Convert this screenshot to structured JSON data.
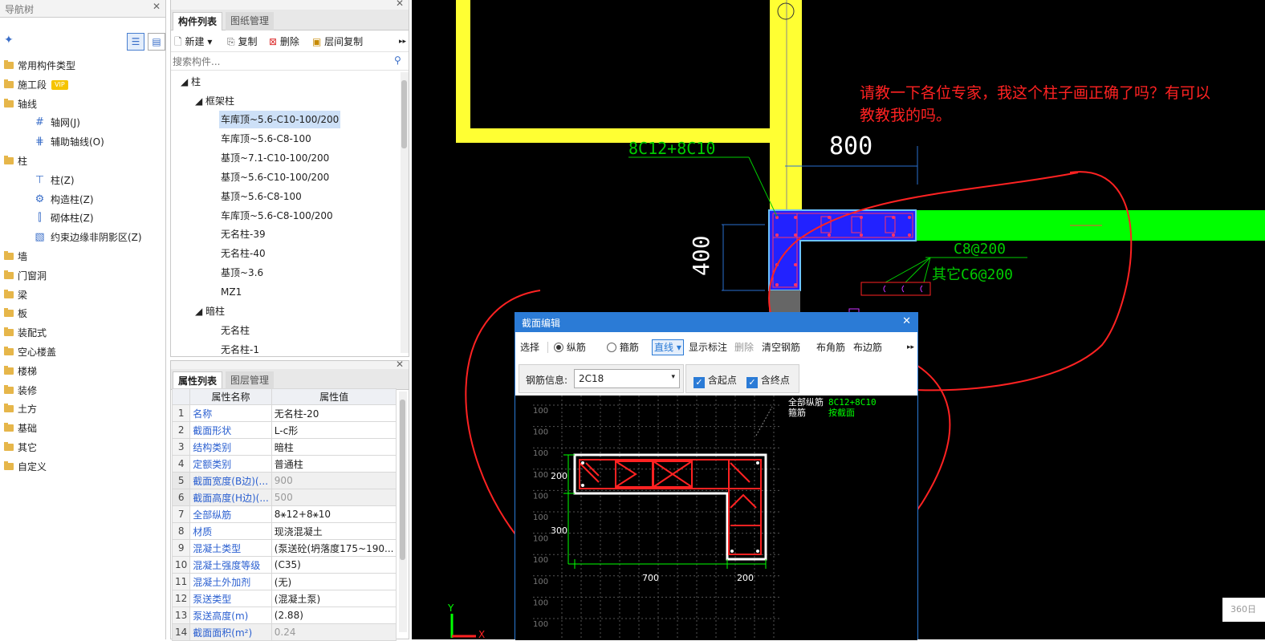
{
  "nav": {
    "title": "导航树",
    "items": [
      {
        "label": "常用构件类型",
        "type": "folder"
      },
      {
        "label": "施工段",
        "type": "folder",
        "badge": "VIP"
      },
      {
        "label": "轴线",
        "type": "open"
      },
      {
        "label": "轴网(J)",
        "type": "child",
        "icon": "grid"
      },
      {
        "label": "辅助轴线(O)",
        "type": "child",
        "icon": "grid2"
      },
      {
        "label": "柱",
        "type": "open"
      },
      {
        "label": "柱(Z)",
        "type": "child",
        "icon": "column",
        "selected": true
      },
      {
        "label": "构造柱(Z)",
        "type": "child",
        "icon": "gear"
      },
      {
        "label": "砌体柱(Z)",
        "type": "child",
        "icon": "column2"
      },
      {
        "label": "约束边缘非阴影区(Z)",
        "type": "child",
        "icon": "hatch"
      },
      {
        "label": "墙",
        "type": "folder"
      },
      {
        "label": "门窗洞",
        "type": "folder"
      },
      {
        "label": "梁",
        "type": "folder"
      },
      {
        "label": "板",
        "type": "folder"
      },
      {
        "label": "装配式",
        "type": "folder"
      },
      {
        "label": "空心楼盖",
        "type": "folder"
      },
      {
        "label": "楼梯",
        "type": "folder"
      },
      {
        "label": "装修",
        "type": "folder"
      },
      {
        "label": "土方",
        "type": "folder"
      },
      {
        "label": "基础",
        "type": "folder"
      },
      {
        "label": "其它",
        "type": "folder"
      },
      {
        "label": "自定义",
        "type": "folder"
      }
    ]
  },
  "components": {
    "tabs": [
      "构件列表",
      "图纸管理"
    ],
    "toolbar": {
      "new": "新建",
      "copy": "复制",
      "delete": "删除",
      "floor_copy": "层间复制"
    },
    "search_placeholder": "搜索构件...",
    "root": "柱",
    "group1": "框架柱",
    "group1_items": [
      "车库顶~5.6-C10-100/200",
      "车库顶~5.6-C8-100",
      "基顶~7.1-C10-100/200",
      "基顶~5.6-C10-100/200",
      "基顶~5.6-C8-100",
      "车库顶~5.6-C8-100/200",
      "无名柱-39",
      "无名柱-40",
      "基顶~3.6",
      "MZ1"
    ],
    "group2": "暗柱",
    "group2_items": [
      "无名柱",
      "无名柱-1"
    ]
  },
  "props": {
    "tabs": [
      "属性列表",
      "图层管理"
    ],
    "headers": [
      "属性名称",
      "属性值"
    ],
    "rows": [
      {
        "n": "1",
        "k": "名称",
        "v": "无名柱-20"
      },
      {
        "n": "2",
        "k": "截面形状",
        "v": "L-c形"
      },
      {
        "n": "3",
        "k": "结构类别",
        "v": "暗柱"
      },
      {
        "n": "4",
        "k": "定额类别",
        "v": "普通柱"
      },
      {
        "n": "5",
        "k": "截面宽度(B边)(...",
        "v": "900",
        "grey": true
      },
      {
        "n": "6",
        "k": "截面高度(H边)(...",
        "v": "500",
        "grey": true
      },
      {
        "n": "7",
        "k": "全部纵筋",
        "v": "8⚹12+8⚹10"
      },
      {
        "n": "8",
        "k": "材质",
        "v": "现浇混凝土"
      },
      {
        "n": "9",
        "k": "混凝土类型",
        "v": "(泵送砼(坍落度175~190..."
      },
      {
        "n": "10",
        "k": "混凝土强度等级",
        "v": "(C35)"
      },
      {
        "n": "11",
        "k": "混凝土外加剂",
        "v": "(无)"
      },
      {
        "n": "12",
        "k": "泵送类型",
        "v": "(混凝土泵)"
      },
      {
        "n": "13",
        "k": "泵送高度(m)",
        "v": "(2.88)"
      },
      {
        "n": "14",
        "k": "截面面积(m²)",
        "v": "0.24",
        "grey": true
      }
    ]
  },
  "cad": {
    "question": [
      "请教一下各位专家，我这个柱子画正确了吗？有可以",
      "教教我的吗。"
    ],
    "dim_800": "800",
    "dim_400": "400",
    "rebar_label": "8C12+8C10",
    "stirrup_label": "C8@200",
    "other_label": "其它C6@200",
    "axis_y": "Y",
    "axis_x": "X",
    "corner_text": "360日"
  },
  "dialog": {
    "title": "截面编辑",
    "toolbar": {
      "select": "选择",
      "longitudinal": "纵筋",
      "stirrup": "箍筋",
      "line": "直线",
      "show_dim": "显示标注",
      "delete": "删除",
      "clear": "清空钢筋",
      "corner": "布角筋",
      "edge": "布边筋"
    },
    "rebar_info_label": "钢筋信息:",
    "rebar_info_value": "2C18",
    "include_start": "含起点",
    "include_end": "含终点",
    "legend": {
      "all_rebar_label": "全部纵筋",
      "all_rebar_value": "8C12+8C10",
      "stirrup_label": "箍筋",
      "stirrup_value": "按截面"
    },
    "grid_label": "100",
    "dims": {
      "d200": "200",
      "d300": "300",
      "d700": "700",
      "d200b": "200"
    }
  },
  "colors": {
    "accent": "#2b7bd6",
    "cad_yellow": "#ffff33",
    "cad_green": "#00ff00",
    "annot_red": "#ff1a1a",
    "cad_blue": "#2222ff"
  }
}
